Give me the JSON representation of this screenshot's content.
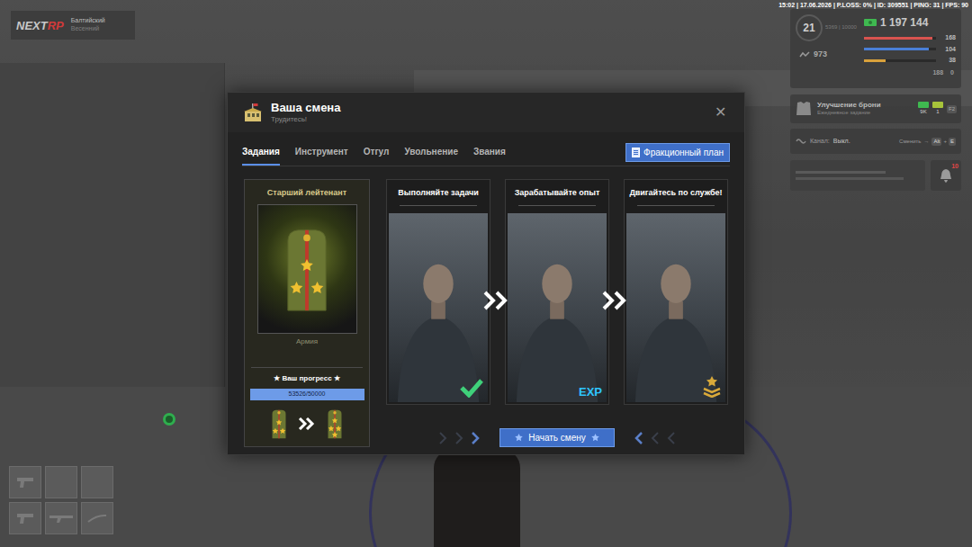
{
  "server": {
    "logo_left": "NEXT",
    "logo_right": "RP",
    "name": "Балтийский",
    "season": "Весенний"
  },
  "status_line": "15:02 | 17.06.2026 | P.LOSS: 0% | ID: 309551 | PING: 31 | FPS: 90",
  "hud": {
    "level": "21",
    "exp": "5369 | 10000",
    "coins": "973",
    "money": "1 197 144",
    "bars": [
      {
        "value": "168",
        "level": 0.95,
        "color": "#d9534f"
      },
      {
        "value": "104",
        "level": 0.9,
        "color": "#4a7fd6"
      },
      {
        "value": "38",
        "level": 0.3,
        "color": "#d9a13b"
      }
    ],
    "extra": [
      "188",
      "0"
    ]
  },
  "armor": {
    "title": "Улучшение брони",
    "subtitle": "Ежедневное задание",
    "reward1": "9K",
    "reward2": "1",
    "key": "F2"
  },
  "channel": {
    "label": "Канал:",
    "value": "Выкл.",
    "switch": "Сменить",
    "arrow": "→",
    "keys": [
      "Alt",
      "E"
    ],
    "separator": "+"
  },
  "notifications": {
    "count": "10"
  },
  "modal": {
    "title": "Ваша смена",
    "subtitle": "Трудитесь!",
    "close": "✕",
    "tabs": [
      {
        "label": "Задания",
        "selected": true
      },
      {
        "label": "Инструмент",
        "selected": false
      },
      {
        "label": "Отгул",
        "selected": false
      },
      {
        "label": "Увольнение",
        "selected": false
      },
      {
        "label": "Звания",
        "selected": false
      }
    ],
    "plan_button": "Фракционный план",
    "rank": {
      "title": "Старший лейтенант",
      "branch": "Армия",
      "progress_label": "★ Ваш прогресс ★",
      "progress": "53526/50000",
      "level": 1
    },
    "steps": [
      {
        "title": "Выполняйте задачи",
        "kind": "check"
      },
      {
        "title": "Зарабатывайте опыт",
        "kind": "exp",
        "badge": "EXP"
      },
      {
        "title": "Двигайтесь по службе!",
        "kind": "rank"
      }
    ],
    "start_button": "Начать смену"
  }
}
